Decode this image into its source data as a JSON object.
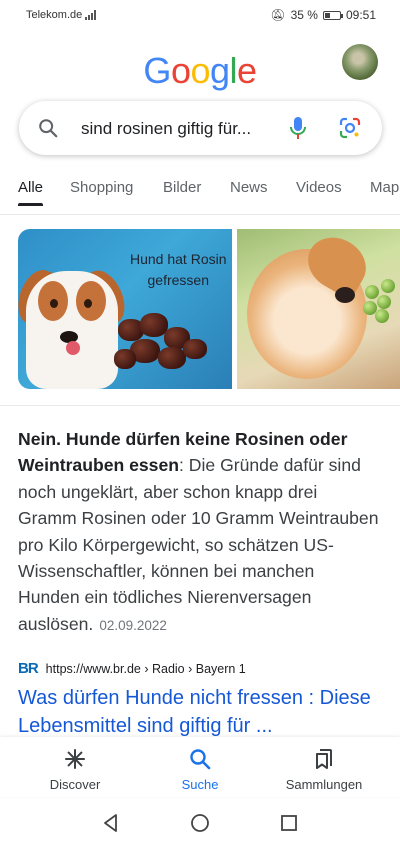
{
  "status_bar": {
    "carrier": "Telekom.de",
    "battery_percent": "35 %",
    "battery_level": 0.35,
    "time": "09:51"
  },
  "header": {
    "logo": [
      "G",
      "o",
      "o",
      "g",
      "l",
      "e"
    ],
    "logo_colors": [
      "#4285F4",
      "#EA4335",
      "#FBBC05",
      "#4285F4",
      "#34A853",
      "#EA4335"
    ]
  },
  "search": {
    "query": "sind rosinen giftig für..."
  },
  "tabs": [
    {
      "label": "Alle",
      "active": true
    },
    {
      "label": "Shopping"
    },
    {
      "label": "Bilder"
    },
    {
      "label": "News"
    },
    {
      "label": "Videos"
    },
    {
      "label": "Map"
    }
  ],
  "images": {
    "image1_caption_line1": "Hund hat Rosin",
    "image1_caption_line2": "gefressen"
  },
  "snippet": {
    "bold": "Nein. Hunde dürfen keine Rosinen oder Weintrauben essen",
    "text": ": Die Gründe dafür sind noch ungeklärt, aber schon knapp drei Gramm Rosinen oder 10 Gramm Weintrauben pro Kilo Körpergewicht, so schätzen US-Wissenschaftler, können bei manchen Hunden ein tödliches Nierenversagen auslösen.",
    "date": "02.09.2022"
  },
  "result": {
    "favicon_text": "BR",
    "url": "https://www.br.de › Radio › Bayern 1",
    "title": "Was dürfen Hunde nicht fressen : Diese Lebensmittel sind giftig für ..."
  },
  "bottom_nav": {
    "discover": "Discover",
    "search": "Suche",
    "collections": "Sammlungen"
  },
  "colors": {
    "accent": "#1a73e8",
    "link": "#1558d6"
  }
}
